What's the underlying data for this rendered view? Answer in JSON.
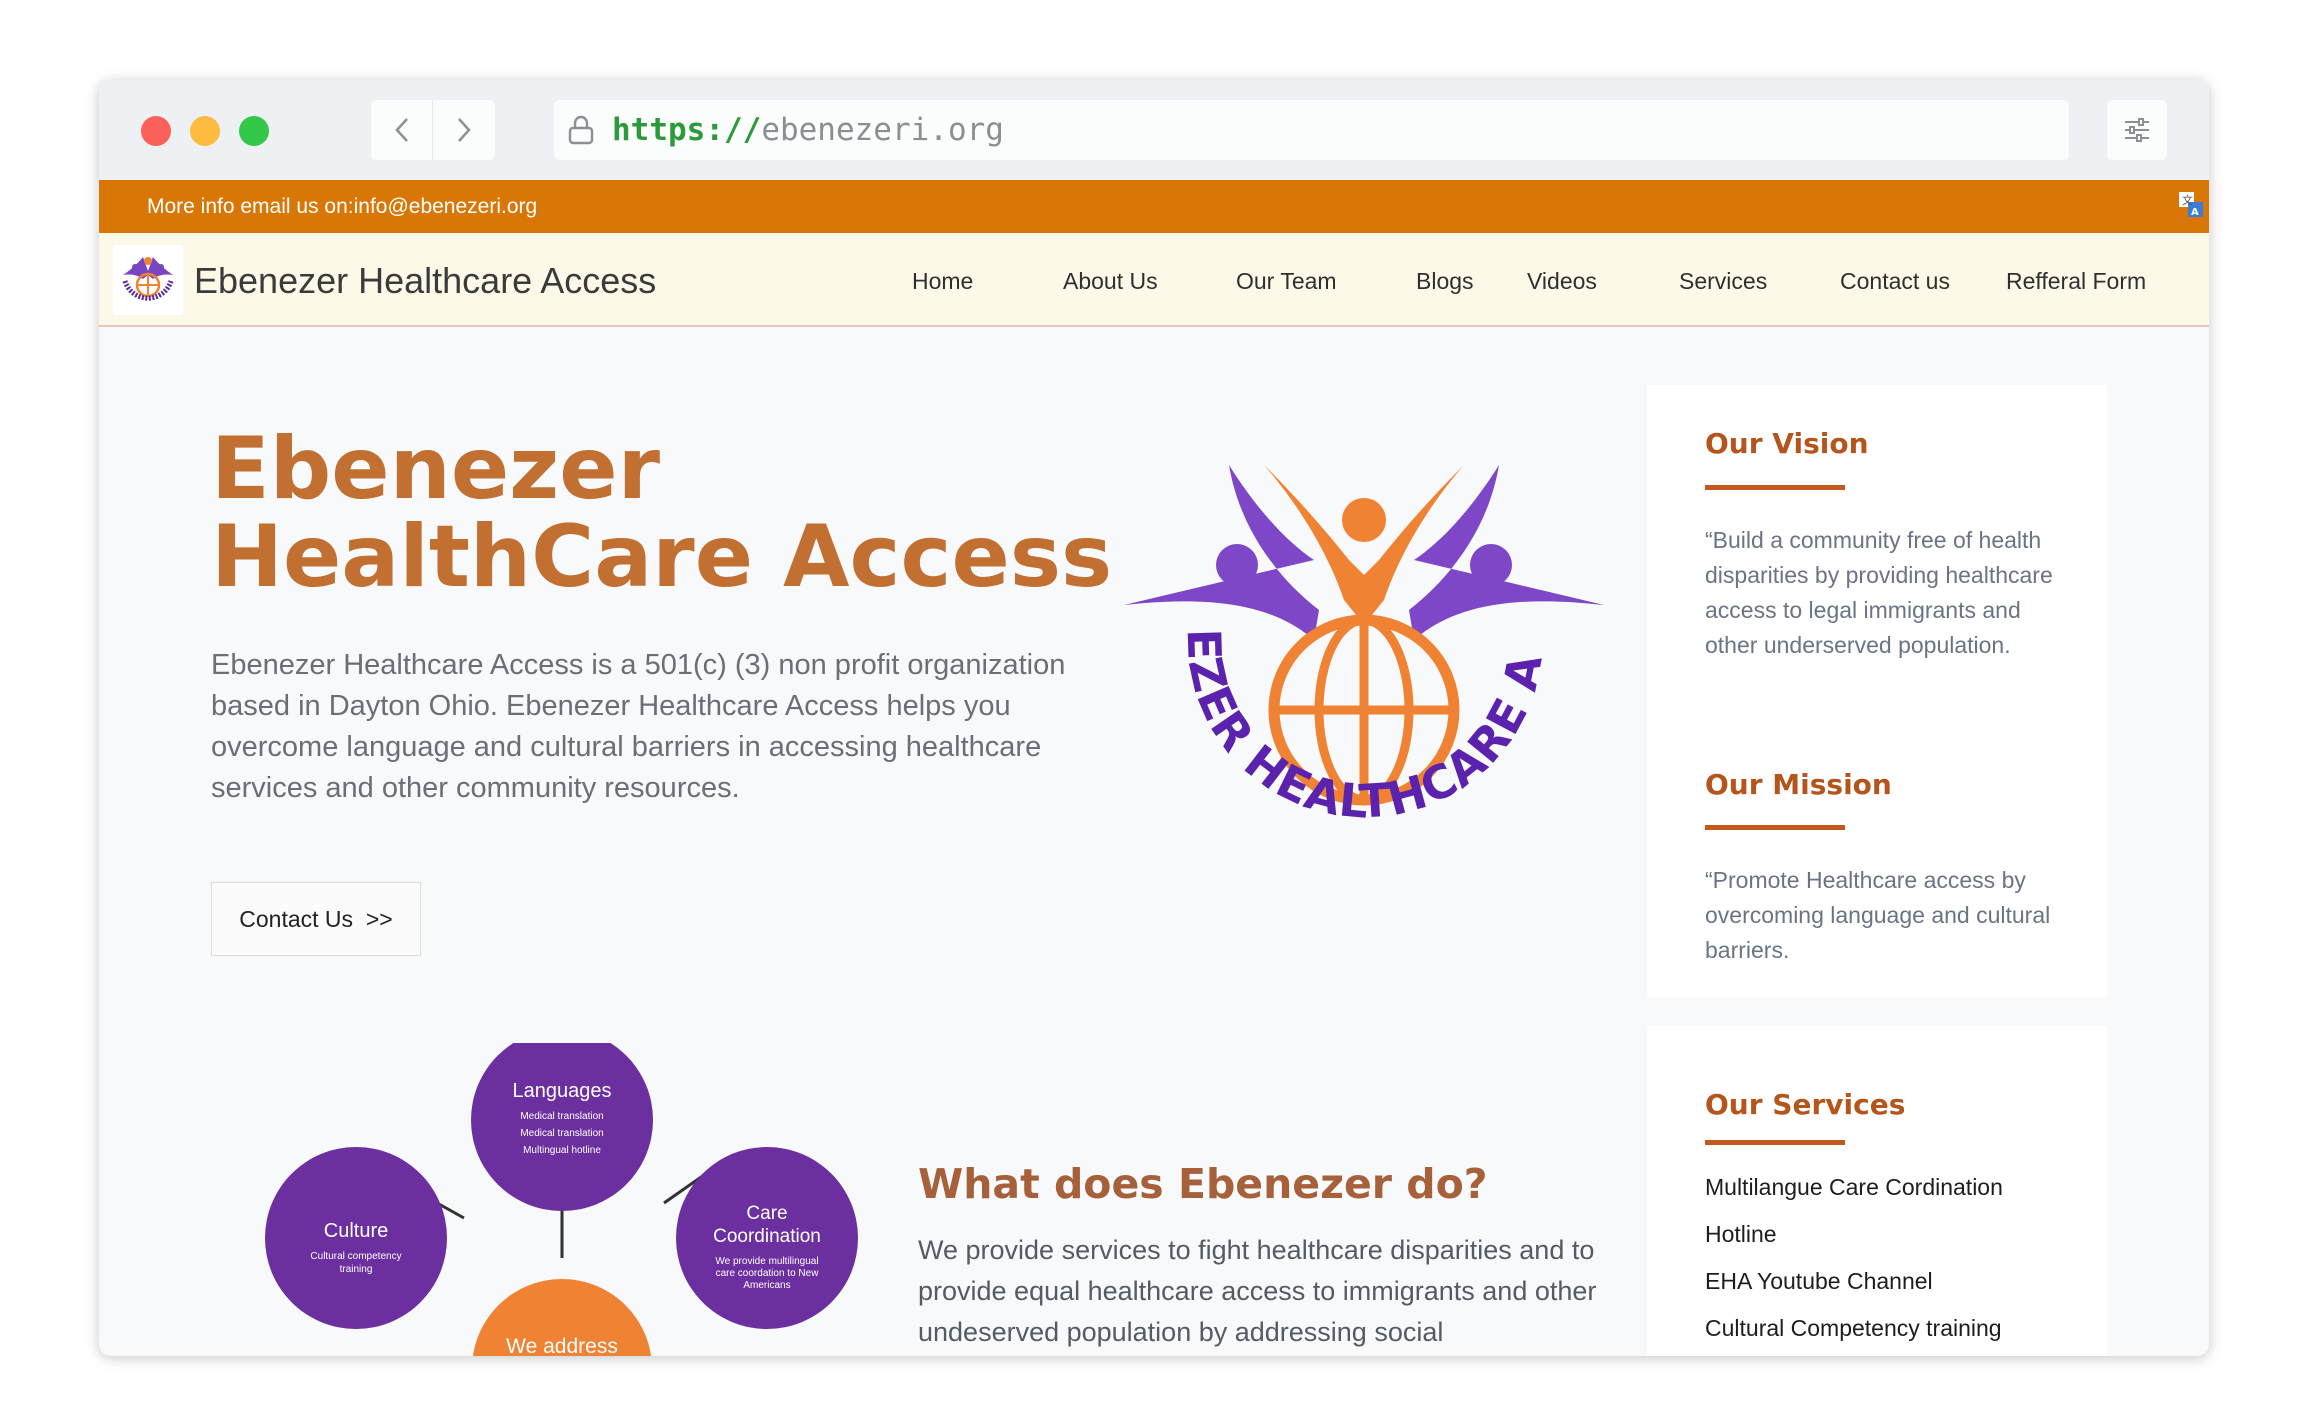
{
  "browser": {
    "url_scheme": "https://",
    "url_host": "ebenezeri.org"
  },
  "topbar": {
    "info": "More info email us on:info@ebenezeri.org"
  },
  "nav": {
    "brand": "Ebenezer Healthcare Access",
    "items": [
      "Home",
      "About Us",
      "Our Team",
      "Blogs",
      "Videos",
      "Services",
      "Contact us",
      "Refferal Form"
    ]
  },
  "hero": {
    "title_line1": "Ebenezer",
    "title_line2": "HealthCare Access",
    "description": "Ebenezer Healthcare Access is a 501(c) (3) non profit organization based in Dayton Ohio. Ebenezer Healthcare Access helps you overcome language and cultural barriers in accessing healthcare services and other community resources.",
    "button": "Contact Us  >>"
  },
  "logo_text": "EBENEZER HEALTHCARE ACCESS",
  "diagram": {
    "languages": {
      "title": "Languages",
      "lines": [
        "Medical translation",
        "Medical translation",
        "Multingual hotline"
      ]
    },
    "culture": {
      "title": "Culture",
      "lines": [
        "Cultural competency",
        "training"
      ]
    },
    "care": {
      "title_line1": "Care",
      "title_line2": "Coordination",
      "lines": [
        "We provide multilingual",
        "care coordation to New",
        "Americans"
      ]
    },
    "center": "We address"
  },
  "what": {
    "title": "What does Ebenezer do?",
    "text": "We provide services to fight healthcare disparities and to provide equal healthcare access to immigrants and other undeserved population by addressing social"
  },
  "vision": {
    "title": "Our Vision",
    "text": "“Build a community free of health disparities by providing healthcare access to legal immigrants and other underserved population."
  },
  "mission": {
    "title": "Our Mission",
    "text": "“Promote Healthcare access by overcoming language and cultural barriers."
  },
  "services": {
    "title": "Our Services",
    "items": [
      "Multilangue Care Cordination",
      "Hotline",
      "EHA Youtube Channel",
      "Cultural Competency training"
    ]
  },
  "colors": {
    "orange_bar": "#d97706",
    "title_orange": "#c26f32",
    "purple": "#6b2fa0",
    "logo_orange": "#ef8233"
  }
}
